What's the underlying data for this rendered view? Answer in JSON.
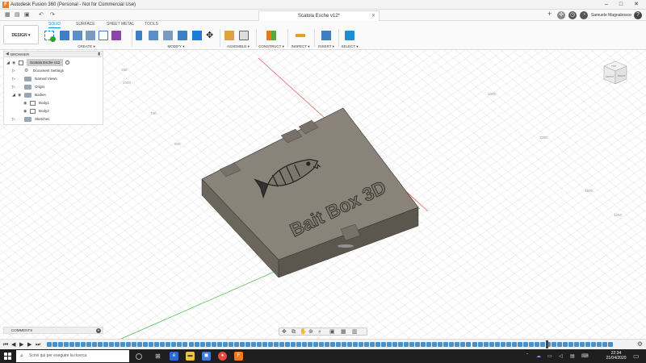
{
  "window": {
    "title": "Autodesk Fusion 360 (Personal - Not for Commercial Use)",
    "logo": "F",
    "min": "–",
    "max": "□",
    "close": "✕"
  },
  "tabbar": {
    "doc_title": "Scatola Esche v12*",
    "doc_close": "✕",
    "user": "Samuele Magnabosco",
    "help": "?"
  },
  "toolbar": {
    "workspace": "DESIGN ▾",
    "tabs": [
      "SOLID",
      "SURFACE",
      "SHEET METAL",
      "TOOLS"
    ],
    "active_tab": "SOLID",
    "groups": {
      "create": "CREATE ▾",
      "modify": "MODIFY ▾",
      "assemble": "ASSEMBLE ▾",
      "construct": "CONSTRUCT ▾",
      "inspect": "INSPECT ▾",
      "insert": "INSERT ▾",
      "select": "SELECT ▾"
    }
  },
  "browser": {
    "title": "BROWSER",
    "root": "Scatola Esche v12",
    "nodes": {
      "document_settings": "Document Settings",
      "named_views": "Named Views",
      "origin": "Origin",
      "bodies": "Bodies",
      "body1": "Body1",
      "body2": "Body2",
      "sketches": "Sketches"
    }
  },
  "comments": {
    "label": "COMMENTS"
  },
  "model": {
    "emboss_text": "Bait Box 3D"
  },
  "axis_ticks": [
    "250",
    "1000",
    "1250",
    "1500",
    "500",
    "750",
    "1000",
    "1250"
  ],
  "viewcube": {
    "face_top": "TOP",
    "face_front": "FRONT",
    "face_right": "RIGHT"
  },
  "timeline": {
    "feature_count": 100,
    "marker_at": 0.88
  },
  "taskbar": {
    "search_placeholder": "Scrivi qui per eseguire la ricerca",
    "time": "22:34",
    "date": "21/04/2020"
  },
  "colors": {
    "accent": "#0696d7",
    "model_top": "#8a8379",
    "model_side_left": "#6b655c",
    "model_side_front": "#5b564e",
    "grid": "#d8d8d8",
    "axis_red": "#e05050",
    "axis_green": "#44bb44"
  }
}
